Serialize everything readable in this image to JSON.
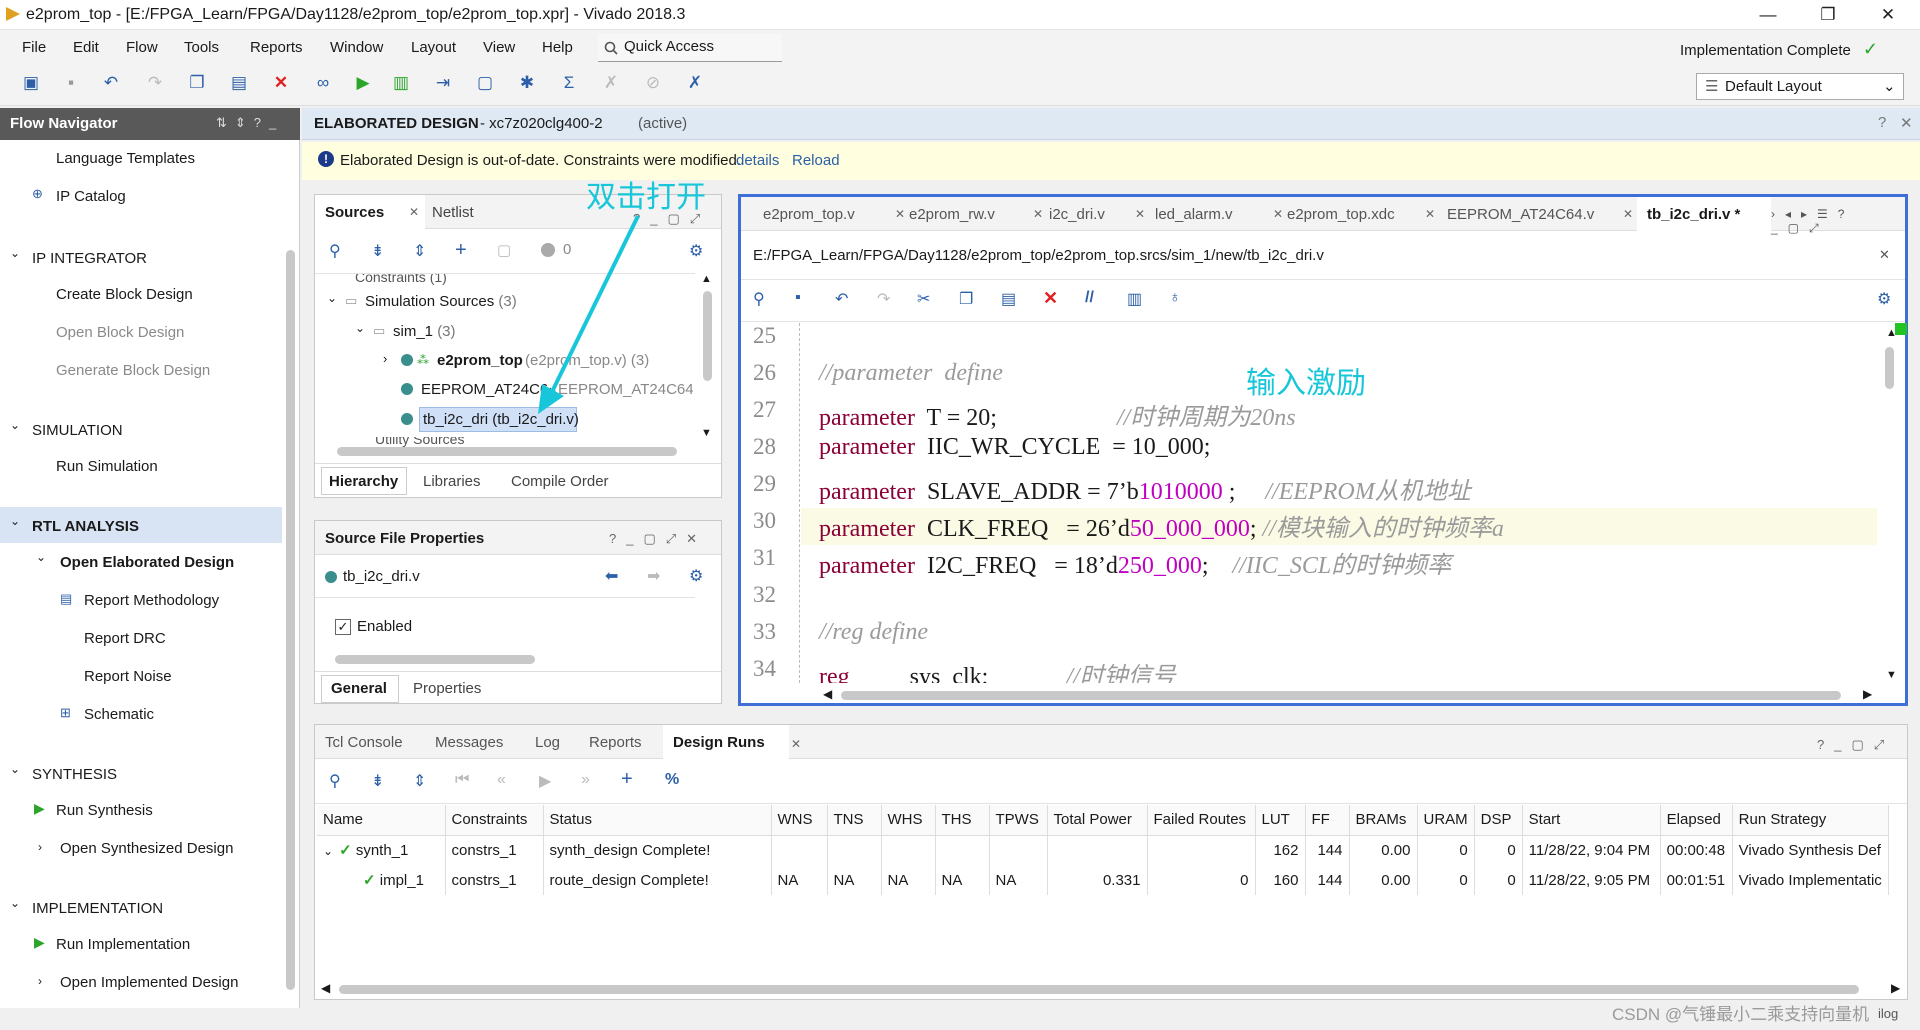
{
  "window": {
    "title": "e2prom_top - [E:/FPGA_Learn/FPGA/Day1128/e2prom_top/e2prom_top.xpr] - Vivado 2018.3",
    "minimize": "—",
    "restore": "❐",
    "close": "✕"
  },
  "menu": [
    "File",
    "Edit",
    "Flow",
    "Tools",
    "Reports",
    "Window",
    "Layout",
    "View",
    "Help"
  ],
  "quick_access": "Quick Access",
  "status": "Implementation Complete",
  "layout_select": "Default Layout",
  "flow_nav": {
    "title": "Flow Navigator",
    "items": [
      {
        "label": "Language Templates",
        "type": "item"
      },
      {
        "label": "IP Catalog",
        "type": "item"
      },
      {
        "label": "IP INTEGRATOR",
        "type": "section"
      },
      {
        "label": "Create Block Design",
        "type": "item"
      },
      {
        "label": "Open Block Design",
        "type": "disabled"
      },
      {
        "label": "Generate Block Design",
        "type": "disabled"
      },
      {
        "label": "SIMULATION",
        "type": "section"
      },
      {
        "label": "Run Simulation",
        "type": "item"
      },
      {
        "label": "RTL ANALYSIS",
        "type": "section"
      },
      {
        "label": "Open Elaborated Design",
        "type": "item"
      },
      {
        "label": "Report Methodology",
        "type": "item"
      },
      {
        "label": "Report DRC",
        "type": "item"
      },
      {
        "label": "Report Noise",
        "type": "item"
      },
      {
        "label": "Schematic",
        "type": "item"
      },
      {
        "label": "SYNTHESIS",
        "type": "section"
      },
      {
        "label": "Run Synthesis",
        "type": "item"
      },
      {
        "label": "Open Synthesized Design",
        "type": "item"
      },
      {
        "label": "IMPLEMENTATION",
        "type": "section"
      },
      {
        "label": "Run Implementation",
        "type": "item"
      },
      {
        "label": "Open Implemented Design",
        "type": "item"
      }
    ]
  },
  "elab": {
    "title": "ELABORATED DESIGN",
    "subtitle": " - xc7z020clg400-2 ",
    "active": "(active)"
  },
  "warning": {
    "text": "Elaborated Design is out-of-date. Constraints were modified.",
    "details": "details",
    "reload": "Reload"
  },
  "sources": {
    "tabs": [
      "Sources",
      "Netlist"
    ],
    "count": "0",
    "tree": [
      {
        "label": "Constraints (1)"
      },
      {
        "label": "Simulation Sources",
        "count": "(3)"
      },
      {
        "label": "sim_1",
        "count": "(3)"
      },
      {
        "label": "e2prom_top",
        "extra": "(e2prom_top.v) (3)"
      },
      {
        "label": "EEPROM_AT24C64",
        "extra": "(EEPROM_AT24C64"
      },
      {
        "label": "tb_i2c_dri (tb_i2c_dri.v)"
      },
      {
        "label": "Utility Sources"
      }
    ],
    "bottom_tabs": [
      "Hierarchy",
      "Libraries",
      "Compile Order"
    ]
  },
  "sfp": {
    "title": "Source File Properties",
    "file": "tb_i2c_dri.v",
    "enabled": "Enabled",
    "tabs": [
      "General",
      "Properties"
    ]
  },
  "editor": {
    "tabs": [
      "e2prom_top.v",
      "e2prom_rw.v",
      "i2c_dri.v",
      "led_alarm.v",
      "e2prom_top.xdc",
      "EEPROM_AT24C64.v",
      "tb_i2c_dri.v *"
    ],
    "path": "E:/FPGA_Learn/FPGA/Day1128/e2prom_top/e2prom_top.srcs/sim_1/new/tb_i2c_dri.v",
    "lines": [
      {
        "n": "25",
        "segs": []
      },
      {
        "n": "26",
        "segs": [
          {
            "t": "//parameter  define",
            "c": "cm"
          }
        ]
      },
      {
        "n": "27",
        "segs": [
          {
            "t": "parameter",
            "c": "kw"
          },
          {
            "t": "  T = 20;                    ",
            "c": ""
          },
          {
            "t": "//时钟周期为20ns",
            "c": "cm"
          }
        ]
      },
      {
        "n": "28",
        "segs": [
          {
            "t": "parameter",
            "c": "kw"
          },
          {
            "t": "  IIC_WR_CYCLE  = 10_000;",
            "c": ""
          }
        ]
      },
      {
        "n": "29",
        "segs": [
          {
            "t": "parameter",
            "c": "kw"
          },
          {
            "t": "  SLAVE_ADDR = 7’b",
            "c": ""
          },
          {
            "t": "1010000",
            "c": "num"
          },
          {
            "t": " ;     ",
            "c": ""
          },
          {
            "t": "//EEPROM从机地址",
            "c": "cm"
          }
        ]
      },
      {
        "n": "30",
        "segs": [
          {
            "t": "parameter",
            "c": "kw"
          },
          {
            "t": "  CLK_FREQ   = 26’d",
            "c": ""
          },
          {
            "t": "50_000_000",
            "c": "num"
          },
          {
            "t": "; ",
            "c": ""
          },
          {
            "t": "//模块输入的时钟频率a",
            "c": "cm"
          }
        ]
      },
      {
        "n": "31",
        "segs": [
          {
            "t": "parameter",
            "c": "kw"
          },
          {
            "t": "  I2C_FREQ   = 18’d",
            "c": ""
          },
          {
            "t": "250_000",
            "c": "num"
          },
          {
            "t": ";    ",
            "c": ""
          },
          {
            "t": "//IIC_SCL的时钟频率",
            "c": "cm"
          }
        ]
      },
      {
        "n": "32",
        "segs": []
      },
      {
        "n": "33",
        "segs": [
          {
            "t": "//reg define",
            "c": "cm"
          }
        ]
      },
      {
        "n": "34",
        "segs": [
          {
            "t": "reg",
            "c": "kw"
          },
          {
            "t": "          sys_clk;             ",
            "c": ""
          },
          {
            "t": "//时钟信号",
            "c": "cm"
          }
        ]
      }
    ]
  },
  "bottom": {
    "tabs": [
      "Tcl Console",
      "Messages",
      "Log",
      "Reports",
      "Design Runs"
    ],
    "columns": [
      "Name",
      "Constraints",
      "Status",
      "WNS",
      "TNS",
      "WHS",
      "THS",
      "TPWS",
      "Total Power",
      "Failed Routes",
      "LUT",
      "FF",
      "BRAMs",
      "URAM",
      "DSP",
      "Start",
      "Elapsed",
      "Run Strategy"
    ],
    "rows": [
      {
        "name": "synth_1",
        "cells": [
          "constrs_1",
          "synth_design Complete!",
          "",
          "",
          "",
          "",
          "",
          "",
          "",
          "162",
          "144",
          "0.00",
          "0",
          "0",
          "11/28/22, 9:04 PM",
          "00:00:48",
          "Vivado Synthesis Def"
        ]
      },
      {
        "name": "impl_1",
        "cells": [
          "constrs_1",
          "route_design Complete!",
          "NA",
          "NA",
          "NA",
          "NA",
          "NA",
          "0.331",
          "0",
          "160",
          "144",
          "0.00",
          "0",
          "0",
          "11/28/22, 9:05 PM",
          "00:01:51",
          "Vivado Implementatic"
        ]
      }
    ]
  },
  "annotations": {
    "dbl": "双击打开",
    "input": "输入激励"
  },
  "watermark": "CSDN @气锤最小二乘支持向量机",
  "corner": "ilog",
  "colors": {
    "accent": "#3d6fd6",
    "select": "#cfe0f7",
    "green": "#2aa52a"
  }
}
